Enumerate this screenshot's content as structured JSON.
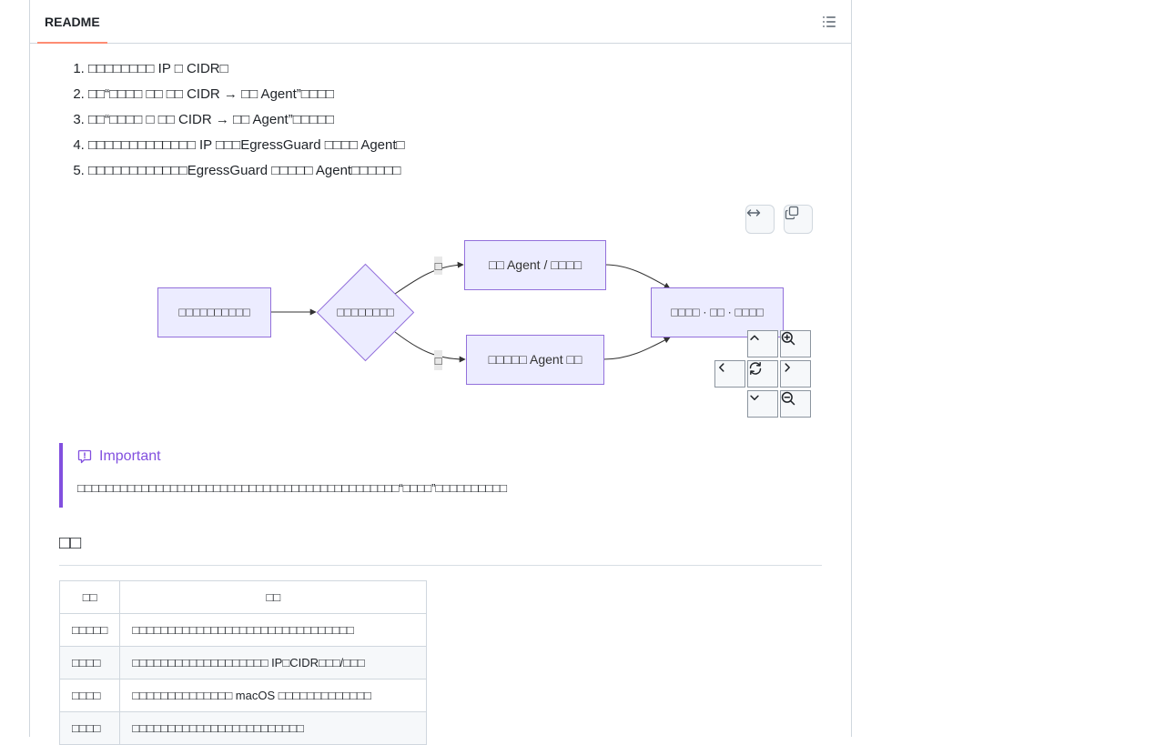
{
  "header": {
    "tab_label": "README",
    "outline_icon": "list-unordered-icon"
  },
  "steps": [
    "□□□□□□□□ IP □ CIDR□",
    "□□“□□□□ □□ □□ CIDR → □□ Agent”□□□□",
    "□□“□□□□ □ □□ CIDR → □□ Agent”□□□□□",
    "□□□□□□□□□□□□□ IP □□□EgressGuard □□□□ Agent□",
    "□□□□□□□□□□□□EgressGuard □□□□□ Agent□□□□□□"
  ],
  "diagram": {
    "toolbar": {
      "expand_icon": "arrows-horizontal-icon",
      "copy_icon": "copy-icon"
    },
    "nodes": {
      "start": "□□□□□□□□□□",
      "decision": "□□□□□□□□",
      "yes_branch": "□□ Agent / □□□□",
      "no_branch": "□□□□□ Agent □□",
      "end": "□□□□ · □□ · □□□□"
    },
    "edge_labels": {
      "yes": "□",
      "no": "□"
    },
    "colors": {
      "node_fill": "#ececff",
      "node_stroke": "#9370db",
      "edge": "#333333"
    },
    "controls": {
      "up_icon": "chevron-up-icon",
      "zoom_in_icon": "zoom-in-icon",
      "left_icon": "chevron-left-icon",
      "reset_icon": "sync-icon",
      "right_icon": "chevron-right-icon",
      "down_icon": "chevron-down-icon",
      "zoom_out_icon": "zoom-out-icon"
    }
  },
  "callout": {
    "title": "Important",
    "text": "□□□□□□□□□□□□□□□□□□□□□□□□□□□□□□□□□□□□□□□□□□□□□“□□□□”□□□□□□□□□□",
    "color": "#8250df"
  },
  "section": {
    "heading": "□□"
  },
  "table": {
    "headers": [
      "□□",
      "□□"
    ],
    "rows": [
      [
        "□□□□□",
        "□□□□□□□□□□□□□□□□□□□□□□□□□□□□□□□"
      ],
      [
        "□□□□",
        "□□□□□□□□□□□□□□□□□□□ IP□CIDR□□□/□□□"
      ],
      [
        "□□□□",
        "□□□□□□□□□□□□□□ macOS □□□□□□□□□□□□□"
      ],
      [
        "□□□□",
        "□□□□□□□□□□□□□□□□□□□□□□□□"
      ]
    ]
  }
}
